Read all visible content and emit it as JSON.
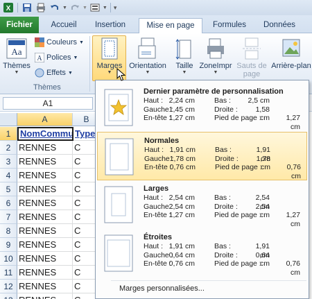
{
  "app": {
    "icon": "excel-icon"
  },
  "qat": {
    "icons": [
      "save-icon",
      "print-preview-icon",
      "undo-icon",
      "redo-icon",
      "customize-icon"
    ]
  },
  "tabs": {
    "file": "Fichier",
    "home": "Accueil",
    "insert": "Insertion",
    "page_layout": "Mise en page",
    "formulas": "Formules",
    "data": "Données"
  },
  "ribbon": {
    "themes_label": "Thèmes",
    "colors_label": "Couleurs",
    "fonts_label": "Polices",
    "effects_label": "Effets",
    "themes_group": "Thèmes",
    "margins_label": "Marges",
    "orientation_label": "Orientation",
    "size_label": "Taille",
    "print_area_label": "ZoneImpr",
    "breaks_label_1": "Sauts de",
    "breaks_label_2": "page",
    "background_label": "Arrière-plan"
  },
  "formula_bar": {
    "name_box": "A1"
  },
  "grid": {
    "columns": [
      "A",
      "B"
    ],
    "rows": [
      {
        "num": "1",
        "a": "NomCommune",
        "b": "Type"
      },
      {
        "num": "2",
        "a": "RENNES",
        "b": "C"
      },
      {
        "num": "3",
        "a": "RENNES",
        "b": "C"
      },
      {
        "num": "4",
        "a": "RENNES",
        "b": "C"
      },
      {
        "num": "5",
        "a": "RENNES",
        "b": "C"
      },
      {
        "num": "6",
        "a": "RENNES",
        "b": "C"
      },
      {
        "num": "7",
        "a": "RENNES",
        "b": "C"
      },
      {
        "num": "8",
        "a": "RENNES",
        "b": "C"
      },
      {
        "num": "9",
        "a": "RENNES",
        "b": "C"
      },
      {
        "num": "10",
        "a": "RENNES",
        "b": "C"
      },
      {
        "num": "11",
        "a": "RENNES",
        "b": "C"
      },
      {
        "num": "12",
        "a": "RENNES",
        "b": "C"
      },
      {
        "num": "13",
        "a": "RENNES",
        "b": "C"
      }
    ]
  },
  "margins_menu": {
    "options": [
      {
        "title": "Dernier paramètre de personnalisation",
        "k_top": "Haut :",
        "top": "2,24 cm",
        "k_bottom": "Bas :",
        "bottom": "2,5 cm",
        "k_left": "Gauche :",
        "left": "1,45 cm",
        "k_right": "Droite :",
        "right": "1,58 cm",
        "k_header": "En-tête :",
        "header": "1,27 cm",
        "k_footer": "Pied de page :",
        "footer": "1,27 cm"
      },
      {
        "title": "Normales",
        "k_top": "Haut :",
        "top": "1,91 cm",
        "k_bottom": "Bas :",
        "bottom": "1,91 cm",
        "k_left": "Gauche :",
        "left": "1,78 cm",
        "k_right": "Droite :",
        "right": "1,78 cm",
        "k_header": "En-tête :",
        "header": "0,76 cm",
        "k_footer": "Pied de page :",
        "footer": "0,76 cm"
      },
      {
        "title": "Larges",
        "k_top": "Haut :",
        "top": "2,54 cm",
        "k_bottom": "Bas :",
        "bottom": "2,54 cm",
        "k_left": "Gauche :",
        "left": "2,54 cm",
        "k_right": "Droite :",
        "right": "2,54 cm",
        "k_header": "En-tête :",
        "header": "1,27 cm",
        "k_footer": "Pied de page :",
        "footer": "1,27 cm"
      },
      {
        "title": "Étroites",
        "k_top": "Haut :",
        "top": "1,91 cm",
        "k_bottom": "Bas :",
        "bottom": "1,91 cm",
        "k_left": "Gauche :",
        "left": "0,64 cm",
        "k_right": "Droite :",
        "right": "0,64 cm",
        "k_header": "En-tête :",
        "header": "0,76 cm",
        "k_footer": "Pied de page :",
        "footer": "0,76 cm"
      }
    ],
    "custom": "Marges personnalisées..."
  }
}
